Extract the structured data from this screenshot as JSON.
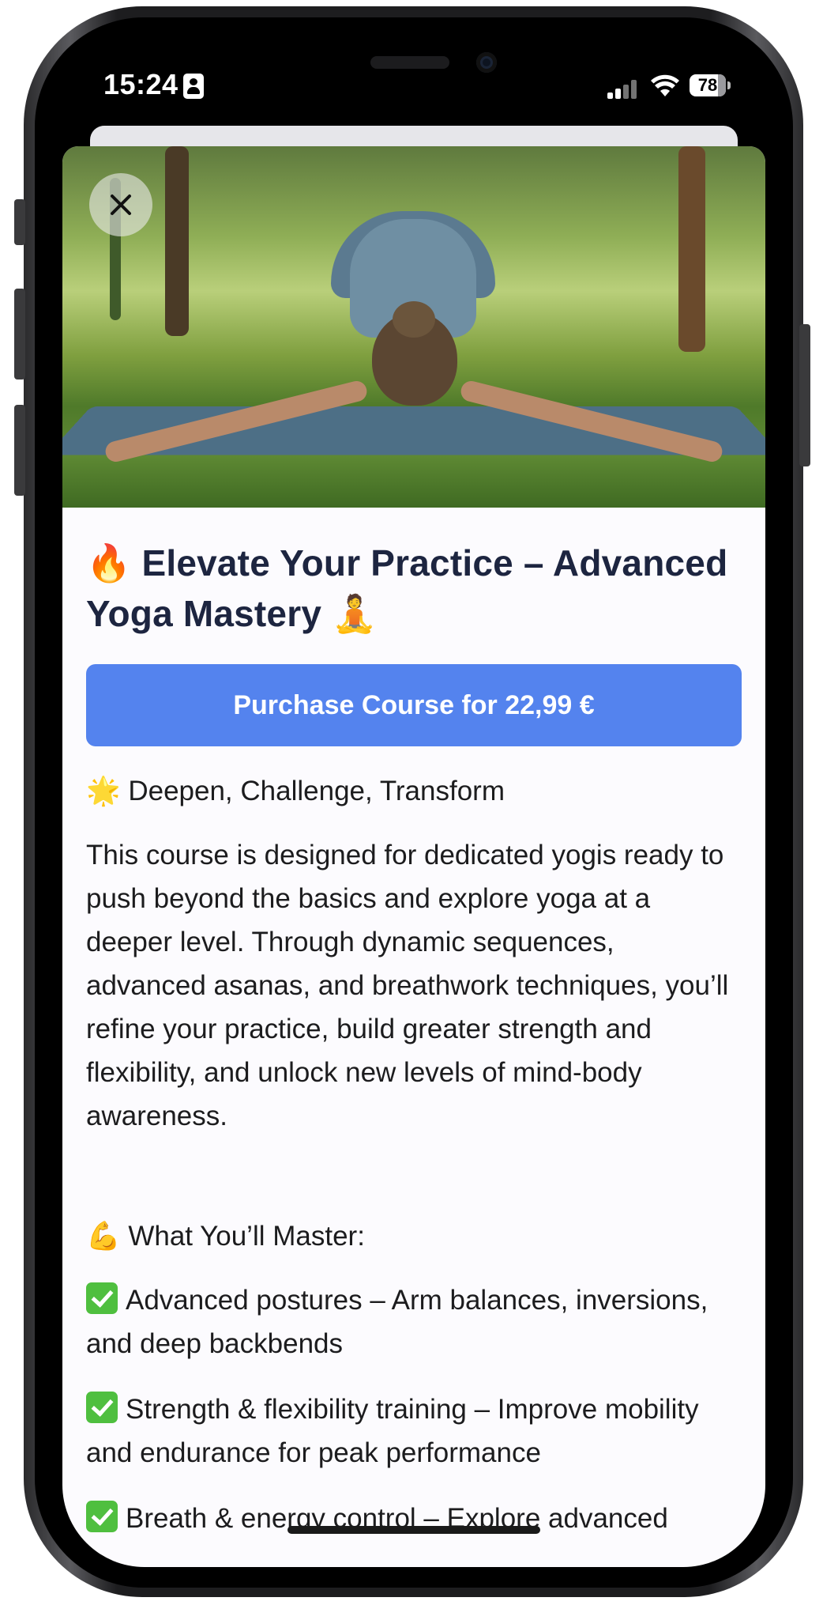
{
  "status_bar": {
    "time": "15:24",
    "battery": "78"
  },
  "course": {
    "hero_image": "woman doing yoga stretch on mat in park",
    "close_icon": "close-icon",
    "title": "Elevate Your Practice – Advanced Yoga Mastery",
    "title_emoji_before": "🔥",
    "title_emoji_after": "🧘",
    "purchase_label": "Purchase Course for 22,99 €",
    "tagline_emoji": "🌟",
    "tagline": "Deepen, Challenge, Transform",
    "description": "This course is designed for dedicated yogis ready to push beyond the basics and explore yoga at a deeper level. Through dynamic sequences, advanced asanas, and breathwork techniques, you’ll refine your practice, build greater strength and flexibility, and unlock new levels of mind-body awareness.",
    "master_emoji": "💪",
    "master_heading": "What You’ll Master:",
    "master_items": [
      "Advanced postures – Arm balances, inversions, and deep backbends",
      "Strength & flexibility training – Improve mobility and endurance for peak performance",
      "Breath & energy control – Explore advanced"
    ]
  },
  "colors": {
    "primary_button": "#5483ee",
    "title_text": "#1d2540",
    "check_green": "#4fbf3f"
  }
}
